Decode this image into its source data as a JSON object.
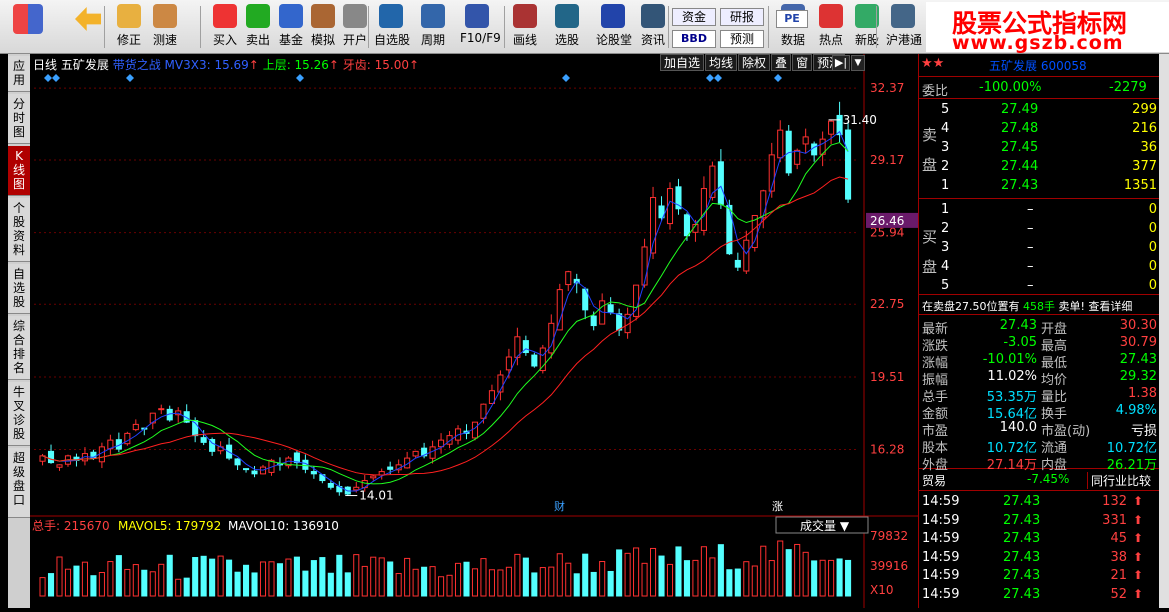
{
  "toolbar": {
    "items": [
      {
        "label": "",
        "icon": "grid-icon"
      },
      {
        "label": "",
        "icon": "back-arrow-icon"
      },
      {
        "label": "修正",
        "icon": "fix-icon"
      },
      {
        "label": "测速",
        "icon": "clock-icon"
      },
      {
        "label": "买入",
        "icon": "buy-icon"
      },
      {
        "label": "卖出",
        "icon": "sell-icon"
      },
      {
        "label": "基金",
        "icon": "fund-icon"
      },
      {
        "label": "模拟",
        "icon": "gavel-icon"
      },
      {
        "label": "开户",
        "icon": "lock-icon"
      },
      {
        "label": "自选股",
        "icon": "star-icon"
      },
      {
        "label": "周期",
        "icon": "period-icon"
      },
      {
        "label": "F10/F9",
        "icon": "f10-icon"
      },
      {
        "label": "画线",
        "icon": "pen-icon"
      },
      {
        "label": "选股",
        "icon": "select-icon"
      },
      {
        "label": "论股堂",
        "icon": "forum-icon"
      },
      {
        "label": "资讯",
        "icon": "news-icon"
      },
      {
        "label": "数据",
        "icon": "pe-icon"
      },
      {
        "label": "热点",
        "icon": "hot-icon"
      },
      {
        "label": "新股",
        "icon": "new-stock-icon"
      },
      {
        "label": "沪港通",
        "icon": "hk-icon"
      }
    ],
    "zijin": "资金",
    "bbd": "BBD",
    "yanbao": "研报",
    "yuce": "预测",
    "pe": "PE"
  },
  "brand": {
    "title": "股票公式指标网",
    "url": "www.gszb.com"
  },
  "left_tabs": [
    "应用",
    "分时图",
    "K线图",
    "个股资料",
    "自选股",
    "综合排名",
    "牛叉诊股",
    "超级盘口"
  ],
  "chart_header": {
    "period": "日线",
    "name": "五矿发展",
    "indicator": "带货之战",
    "mv": "MV3X3: 15.69",
    "up": "上层: 15.26",
    "down": "牙齿: 15.00",
    "buttons": [
      "加自选",
      "均线",
      "除权",
      "叠",
      "窗",
      "预测"
    ]
  },
  "price_axis": [
    "32.37",
    "29.17",
    "25.94",
    "22.75",
    "19.51",
    "16.28"
  ],
  "current_price_tag": "26.46",
  "annotations": {
    "high": "31.40",
    "low": "14.01",
    "cai": "财",
    "zhang": "涨"
  },
  "volume": {
    "label": "总手: 215670",
    "mavol5": "MAVOL5: 179792",
    "mavol10": "MAVOL10: 136910",
    "dropdown": "成交量",
    "axis": [
      "79832",
      "39916"
    ],
    "unit": "X10"
  },
  "quote": {
    "code_line": "五矿发展 600058",
    "weibi_label": "委比",
    "weibi": "-100.00%",
    "weicha": "-2279",
    "sell_label": "卖盘",
    "buy_label": "买盘",
    "asks": [
      {
        "lv": "5",
        "price": "27.49",
        "vol": "299"
      },
      {
        "lv": "4",
        "price": "27.48",
        "vol": "216"
      },
      {
        "lv": "3",
        "price": "27.45",
        "vol": "36"
      },
      {
        "lv": "2",
        "price": "27.44",
        "vol": "377"
      },
      {
        "lv": "1",
        "price": "27.43",
        "vol": "1351"
      }
    ],
    "bids": [
      {
        "lv": "1",
        "price": "–",
        "vol": "0"
      },
      {
        "lv": "2",
        "price": "–",
        "vol": "0"
      },
      {
        "lv": "3",
        "price": "–",
        "vol": "0"
      },
      {
        "lv": "4",
        "price": "–",
        "vol": "0"
      },
      {
        "lv": "5",
        "price": "–",
        "vol": "0"
      }
    ],
    "notice": "在卖盘27.50位置有",
    "notice_vol": "458手",
    "notice_tail": "卖单! 查看详细",
    "stats": [
      [
        "最新",
        "27.43",
        "开盘",
        "30.30"
      ],
      [
        "涨跌",
        "-3.05",
        "最高",
        "30.79"
      ],
      [
        "涨幅",
        "-10.01%",
        "最低",
        "27.43"
      ],
      [
        "振幅",
        "11.02%",
        "均价",
        "29.32"
      ],
      [
        "总手",
        "53.35万",
        "量比",
        "1.38"
      ],
      [
        "金额",
        "15.64亿",
        "换手",
        "4.98%"
      ],
      [
        "市盈",
        "140.0",
        "市盈(动)",
        "亏损"
      ],
      [
        "股本",
        "10.72亿",
        "流通",
        "10.72亿"
      ],
      [
        "外盘",
        "27.14万",
        "内盘",
        "26.21万"
      ]
    ],
    "industry": "贸易",
    "industry_chg": "-7.45%",
    "industry_btn": "同行业比较",
    "ticks": [
      {
        "t": "14:59",
        "p": "27.43",
        "v": "132"
      },
      {
        "t": "14:59",
        "p": "27.43",
        "v": "331"
      },
      {
        "t": "14:59",
        "p": "27.43",
        "v": "45"
      },
      {
        "t": "14:59",
        "p": "27.43",
        "v": "38"
      },
      {
        "t": "14:59",
        "p": "27.43",
        "v": "21"
      },
      {
        "t": "14:59",
        "p": "27.43",
        "v": "52"
      }
    ]
  },
  "chart_data": {
    "type": "candlestick",
    "y_range": [
      13.5,
      33.0
    ],
    "closes": [
      16.0,
      15.7,
      15.6,
      16.0,
      15.8,
      16.1,
      15.9,
      16.4,
      16.7,
      16.3,
      17.0,
      17.4,
      17.2,
      17.9,
      18.1,
      17.6,
      18.0,
      17.5,
      16.9,
      16.6,
      16.2,
      16.4,
      15.9,
      15.6,
      15.4,
      15.2,
      15.5,
      15.8,
      15.6,
      15.9,
      15.7,
      15.4,
      15.2,
      14.9,
      14.6,
      14.4,
      14.3,
      14.6,
      14.9,
      15.1,
      15.3,
      15.4,
      15.6,
      15.9,
      16.2,
      16.0,
      16.4,
      16.7,
      16.9,
      17.2,
      17.0,
      17.5,
      18.3,
      18.9,
      19.6,
      20.4,
      21.3,
      20.6,
      20.0,
      20.8,
      21.9,
      23.4,
      24.2,
      23.7,
      22.5,
      21.8,
      22.9,
      22.4,
      21.6,
      22.3,
      23.6,
      25.3,
      27.5,
      26.6,
      27.9,
      27.0,
      25.8,
      26.3,
      27.9,
      28.9,
      27.2,
      25.0,
      24.4,
      25.6,
      26.7,
      27.8,
      29.4,
      30.5,
      28.6,
      29.6,
      30.2,
      29.4,
      30.1,
      30.9,
      30.3,
      27.43
    ]
  }
}
